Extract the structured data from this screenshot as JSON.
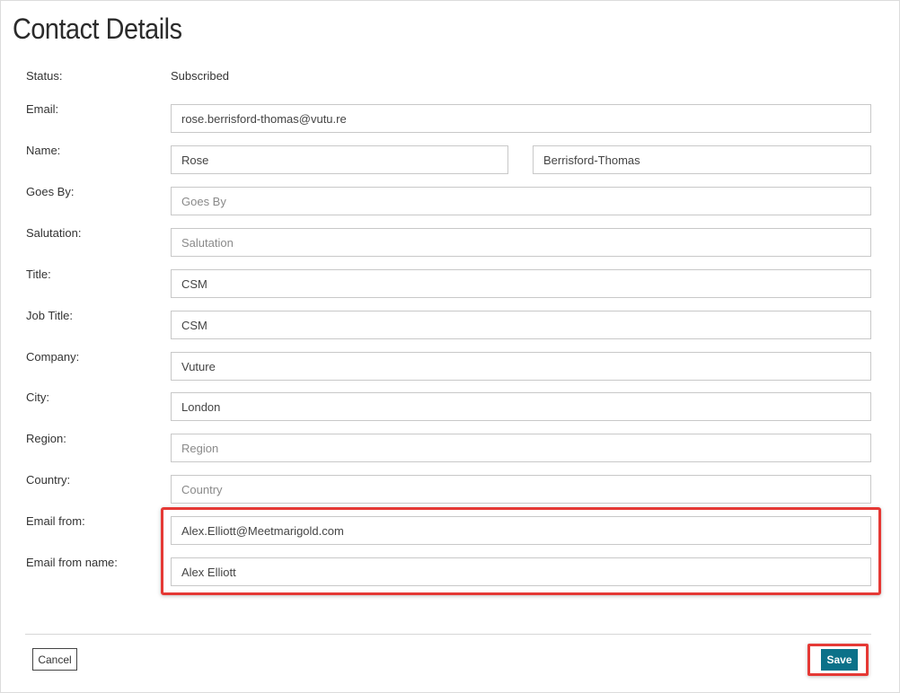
{
  "page": {
    "title": "Contact Details"
  },
  "status": {
    "label": "Status:",
    "value": "Subscribed"
  },
  "fields": {
    "email": {
      "label": "Email:",
      "value": "rose.berrisford-thomas@vutu.re",
      "placeholder": ""
    },
    "name": {
      "label": "Name:",
      "first_value": "Rose",
      "last_value": "Berrisford-Thomas"
    },
    "goes_by": {
      "label": "Goes By:",
      "value": "",
      "placeholder": "Goes By"
    },
    "salutation": {
      "label": "Salutation:",
      "value": "",
      "placeholder": "Salutation"
    },
    "title": {
      "label": "Title:",
      "value": "CSM",
      "placeholder": ""
    },
    "job_title": {
      "label": "Job Title:",
      "value": "CSM",
      "placeholder": ""
    },
    "company": {
      "label": "Company:",
      "value": "Vuture",
      "placeholder": ""
    },
    "city": {
      "label": "City:",
      "value": "London",
      "placeholder": ""
    },
    "region": {
      "label": "Region:",
      "value": "",
      "placeholder": "Region"
    },
    "country": {
      "label": "Country:",
      "value": "",
      "placeholder": "Country"
    },
    "email_from": {
      "label": "Email from:",
      "value": "Alex.Elliott@Meetmarigold.com",
      "placeholder": ""
    },
    "email_from_name": {
      "label": "Email from name:",
      "value": "Alex Elliott",
      "placeholder": ""
    }
  },
  "actions": {
    "cancel_label": "Cancel",
    "save_label": "Save"
  },
  "colors": {
    "accent": "#0b7189",
    "highlight": "#e53935",
    "border": "#c8c8c8"
  }
}
